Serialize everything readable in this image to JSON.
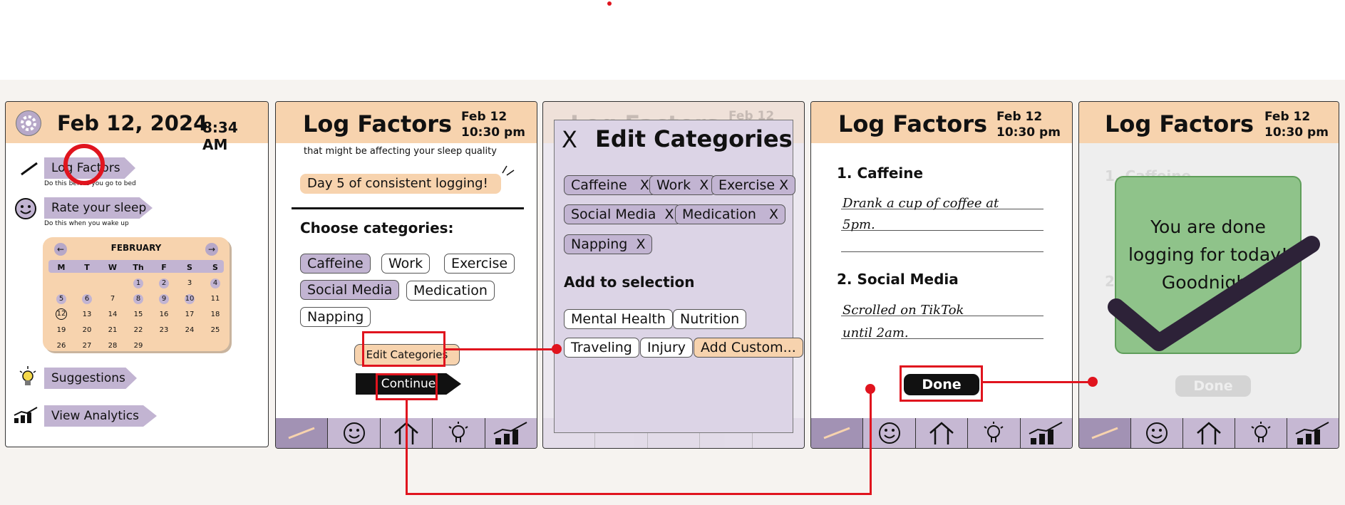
{
  "screen1": {
    "date": "Feb 12, 2024",
    "time": "8:34 AM",
    "log_factors": "Log Factors",
    "log_hint": "Do this before you go to bed",
    "rate_sleep": "Rate your sleep",
    "rate_hint": "Do this when you wake up",
    "calendar": {
      "month": "FEBRUARY",
      "weekdays": [
        "M",
        "T",
        "W",
        "Th",
        "F",
        "S",
        "S"
      ],
      "rows": [
        [
          "",
          "",
          "",
          "1",
          "2",
          "3",
          "4"
        ],
        [
          "5",
          "6",
          "7",
          "8",
          "9",
          "10",
          "11"
        ],
        [
          "12",
          "13",
          "14",
          "15",
          "16",
          "17",
          "18"
        ],
        [
          "19",
          "20",
          "21",
          "22",
          "23",
          "24",
          "25"
        ],
        [
          "26",
          "27",
          "28",
          "29",
          "",
          "",
          ""
        ]
      ],
      "logged_days": [
        "1",
        "2",
        "4",
        "5",
        "6",
        "8",
        "9",
        "10"
      ],
      "today": "12"
    },
    "suggestions": "Suggestions",
    "view_analytics": "View Analytics"
  },
  "screen2": {
    "title": "Log Factors",
    "date_line1": "Feb 12",
    "date_line2": "10:30 pm",
    "subtitle": "that might be affecting your sleep quality",
    "streak": "Day 5 of consistent logging!",
    "choose": "Choose categories:",
    "tags": [
      {
        "label": "Caffeine",
        "selected": true
      },
      {
        "label": "Work",
        "selected": false
      },
      {
        "label": "Exercise",
        "selected": false
      },
      {
        "label": "Social Media",
        "selected": true
      },
      {
        "label": "Medication",
        "selected": false
      },
      {
        "label": "Napping",
        "selected": false
      }
    ],
    "edit_categories": "Edit Categories",
    "continue": "Continue"
  },
  "screen3": {
    "close": "X",
    "title": "Edit Categories",
    "bg_title": "Log Factors",
    "bg_date": "Feb 12",
    "current": [
      "Caffeine",
      "Work",
      "Exercise",
      "Social Media",
      "Medication",
      "Napping"
    ],
    "remove_symbol": "X",
    "add_heading": "Add to selection",
    "add_options": [
      "Mental Health",
      "Nutrition",
      "Traveling",
      "Injury",
      "Add Custom..."
    ]
  },
  "screen4": {
    "title": "Log Factors",
    "date_line1": "Feb 12",
    "date_line2": "10:30 pm",
    "factor1": "1. Caffeine",
    "note1_line1": "Drank a cup of coffee at",
    "note1_line2": "5pm.",
    "factor2": "2. Social Media",
    "note2_line1": "Scrolled on TikTok",
    "note2_line2": "until 2am.",
    "done": "Done"
  },
  "screen5": {
    "title": "Log Factors",
    "date_line1": "Feb 12",
    "date_line2": "10:30 pm",
    "bg_factor1": "1. Caffeine",
    "bg_factor2": "2.",
    "message_line1": "You are done",
    "message_line2": "logging for today!",
    "message_line3": "Goodnight",
    "done": "Done"
  },
  "nav_icons": [
    "pencil-icon",
    "smiley-icon",
    "home-icon",
    "lightbulb-icon",
    "analytics-icon"
  ],
  "colors": {
    "header": "#f7d3ae",
    "lavender": "#c2b4d2",
    "nav": "#c6b8d3",
    "annotation": "#e0141e",
    "success": "#8fc38a"
  }
}
